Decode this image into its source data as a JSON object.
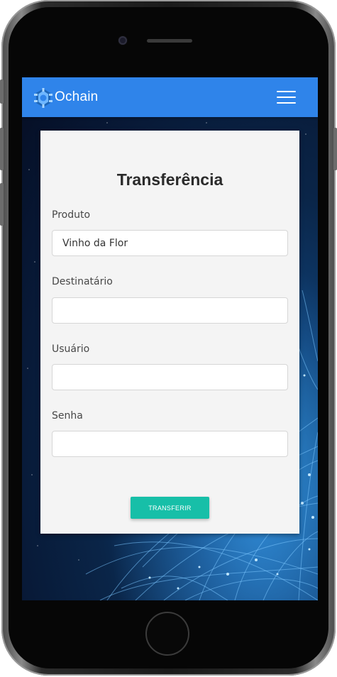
{
  "app": {
    "brand": "Ochain"
  },
  "navbar": {
    "logo_icon": "gear-logo-icon",
    "menu_icon": "hamburger-icon"
  },
  "form": {
    "title": "Transferência",
    "fields": [
      {
        "label": "Produto",
        "value": "Vinho da Flor",
        "type": "text"
      },
      {
        "label": "Destinatário",
        "value": "",
        "type": "text"
      },
      {
        "label": "Usuário",
        "value": "",
        "type": "text"
      },
      {
        "label": "Senha",
        "value": "",
        "type": "password"
      }
    ],
    "submit_label": "TRANSFERIR"
  },
  "colors": {
    "navbar": "#2f84ea",
    "button": "#17bfa8",
    "card": "#f4f4f4"
  }
}
